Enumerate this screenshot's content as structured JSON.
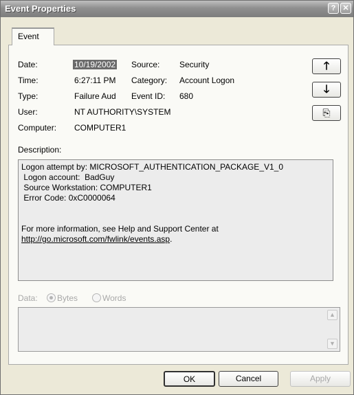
{
  "window": {
    "title": "Event Properties",
    "help_label": "?",
    "close_label": "✕"
  },
  "tabs": [
    {
      "label": "Event"
    }
  ],
  "fields": {
    "date_label": "Date:",
    "date_value": "10/19/2002",
    "source_label": "Source:",
    "source_value": "Security",
    "time_label": "Time:",
    "time_value": "6:27:11 PM",
    "category_label": "Category:",
    "category_value": "Account Logon",
    "type_label": "Type:",
    "type_value": "Failure Aud",
    "event_id_label": "Event ID:",
    "event_id_value": "680",
    "user_label": "User:",
    "user_value": "NT AUTHORITY\\SYSTEM",
    "computer_label": "Computer:",
    "computer_value": "COMPUTER1"
  },
  "nav_buttons": {
    "up": "🡑",
    "down": "🡓",
    "copy": "⎘"
  },
  "description": {
    "label": "Description:",
    "lines": [
      "Logon attempt by: MICROSOFT_AUTHENTICATION_PACKAGE_V1_0",
      " Logon account:  BadGuy",
      " Source Workstation: COMPUTER1",
      " Error Code: 0xC0000064"
    ],
    "help_text": "For more information, see Help and Support Center at",
    "link": "http://go.microsoft.com/fwlink/events.asp",
    "link_suffix": "."
  },
  "data_section": {
    "label": "Data:",
    "option_bytes": "Bytes",
    "option_words": "Words",
    "selected": "Bytes"
  },
  "footer": {
    "ok": "OK",
    "cancel": "Cancel",
    "apply": "Apply"
  },
  "icons": {
    "help": "help-icon",
    "close": "close-icon",
    "up": "up-arrow-icon",
    "down": "down-arrow-icon",
    "copy": "copy-icon"
  }
}
